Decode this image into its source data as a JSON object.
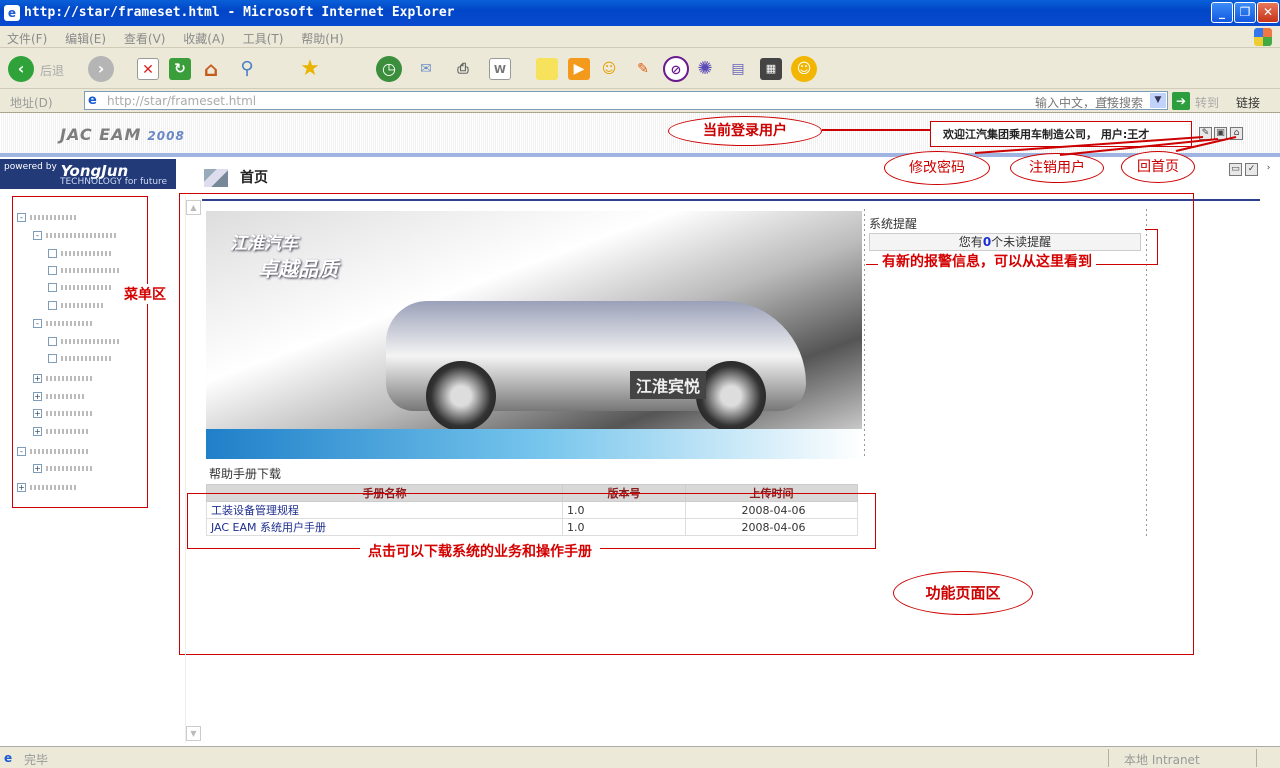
{
  "window": {
    "title": "http://star/frameset.html - Microsoft Internet Explorer",
    "minimize": "_",
    "maximize": "❐",
    "close": "✕"
  },
  "browser": {
    "menu_items": [
      "文件(F)",
      "编辑(E)",
      "查看(V)",
      "收藏(A)",
      "工具(T)",
      "帮助(H)"
    ],
    "toolbar": {
      "back": "后退",
      "stop": "✕",
      "refresh": "↻",
      "home": "⌂"
    },
    "address": {
      "label": "地址(D)",
      "url": "http://star/frameset.html",
      "search_placeholder": "输入中文，直接搜索",
      "go": "转到",
      "links": "链接"
    },
    "status": {
      "text": "完毕",
      "zone": "本地 Intranet"
    }
  },
  "header": {
    "logo": "JAC EAM",
    "year": "2008",
    "welcome_text": "欢迎江汽集团乘用车制造公司，   用户:王才"
  },
  "sidebar": {
    "powered_by": "powered by",
    "brand": "YongJun",
    "tagline": "TECHNOLOGY for future",
    "menu_label": "菜单区"
  },
  "main": {
    "page_title": "首页",
    "car_slogan_1": "江淮汽车",
    "car_slogan_2": "卓越品质",
    "car_plate": "江淮宾悦",
    "system_reminder": {
      "title": "系统提醒",
      "text_prefix": "您有",
      "count": "0",
      "text_suffix": "个未读提醒"
    },
    "download_title": "帮助手册下载",
    "manual_table": {
      "headers": [
        "手册名称",
        "版本号",
        "上传时间"
      ],
      "rows": [
        {
          "name": "工装设备管理规程",
          "version": "1.0",
          "date": "2008-04-06"
        },
        {
          "name": "JAC EAM 系统用户手册",
          "version": "1.0",
          "date": "2008-04-06"
        }
      ]
    }
  },
  "annotations": {
    "current_user": "当前登录用户",
    "change_password": "修改密码",
    "logout": "注销用户",
    "home": "回首页",
    "menu_area": "菜单区",
    "alarm_info": "有新的报警信息，可以从这里看到",
    "download_hint": "点击可以下载系统的业务和操作手册",
    "function_area": "功能页面区"
  },
  "colors": {
    "annotation_red": "#cc0000",
    "title_blue": "#0046c7",
    "header_accent": "#2d3f8f"
  }
}
